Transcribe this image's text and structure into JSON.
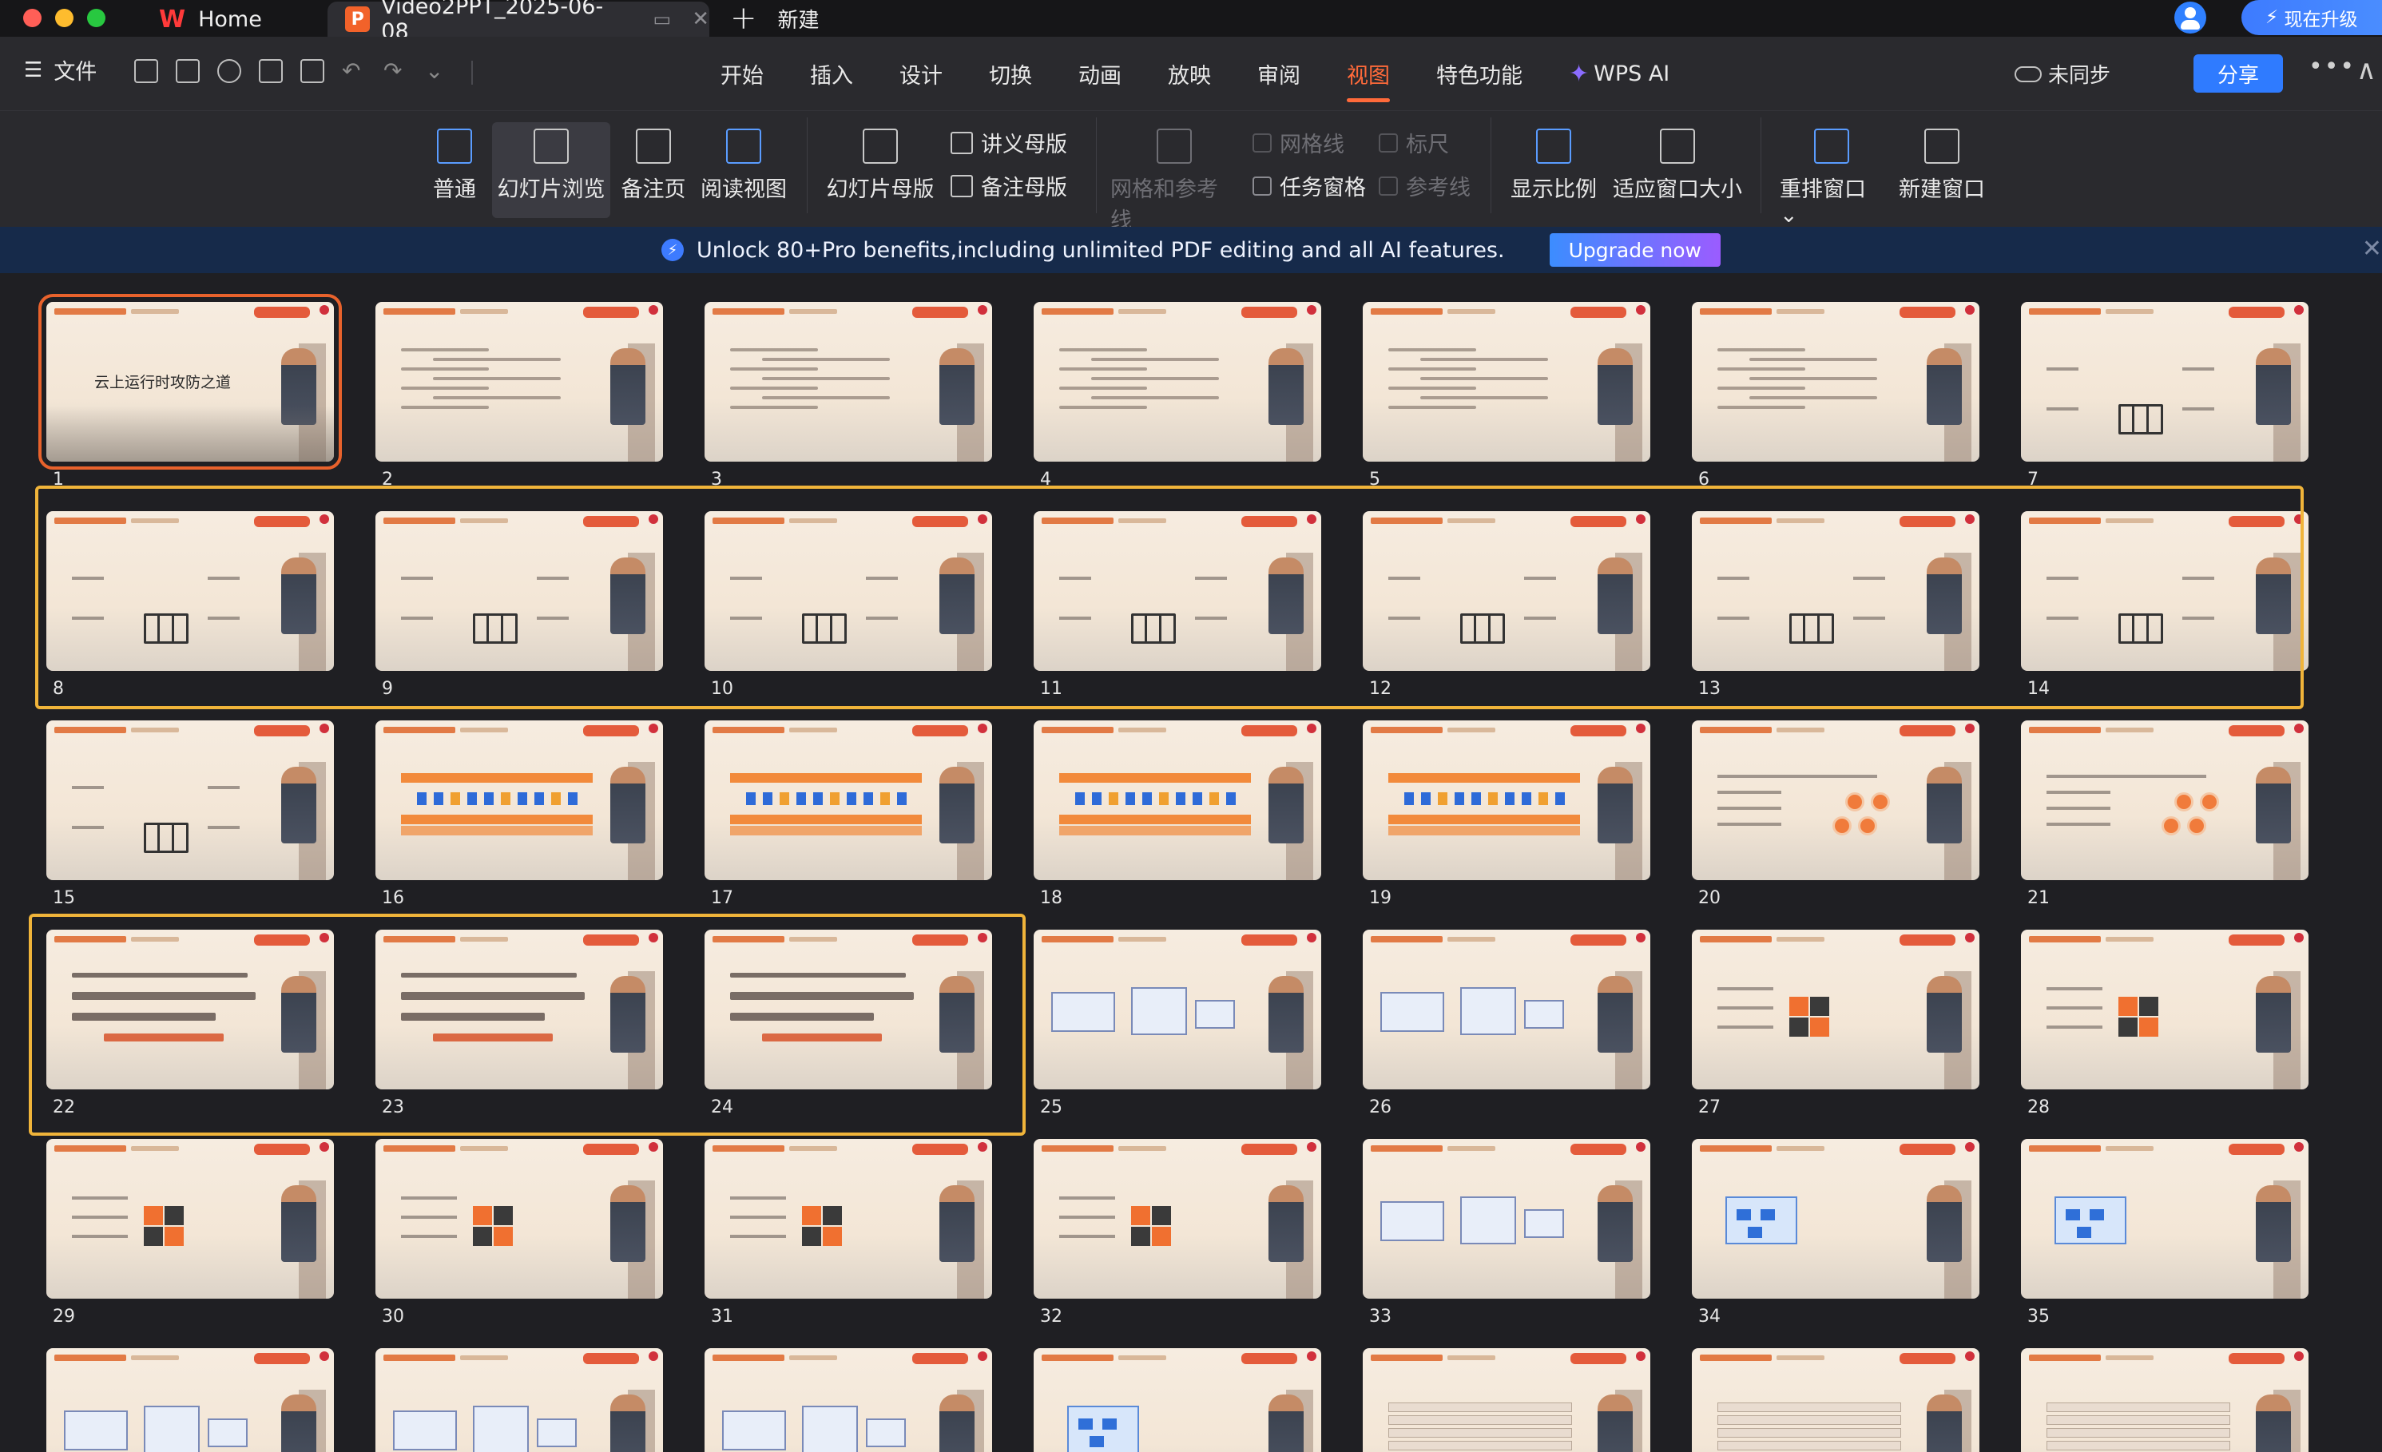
{
  "titlebar": {
    "home_tab": "Home",
    "doc_tab": "Video2PPT_2025-06-08_",
    "new_tab": "新建",
    "upgrade": "现在升级"
  },
  "menubar": {
    "file": "文件",
    "tabs": [
      "开始",
      "插入",
      "设计",
      "切换",
      "动画",
      "放映",
      "审阅",
      "视图",
      "特色功能",
      "WPS AI"
    ],
    "active_tab": "视图",
    "sync": "未同步",
    "share": "分享"
  },
  "ribbon": {
    "normal": "普通",
    "slide_sorter": "幻灯片浏览",
    "notes_page": "备注页",
    "reading_view": "阅读视图",
    "slide_master": "幻灯片母版",
    "handout_master": "讲义母版",
    "notes_master": "备注母版",
    "grid_guides": "网格和参考线",
    "gridlines": "网格线",
    "ruler": "标尺",
    "task_pane": "任务窗格",
    "guides": "参考线",
    "zoom": "显示比例",
    "fit_window": "适应窗口大小",
    "arrange_windows": "重排窗口",
    "new_window": "新建窗口"
  },
  "promo": {
    "text": "Unlock 80+Pro benefits,including unlimited PDF editing and all AI features.",
    "button": "Upgrade now"
  },
  "slide1_title": "云上运行时攻防之道",
  "slides": [
    {
      "n": "1",
      "v": "title"
    },
    {
      "n": "2",
      "v": "text"
    },
    {
      "n": "3",
      "v": "text"
    },
    {
      "n": "4",
      "v": "text"
    },
    {
      "n": "5",
      "v": "text"
    },
    {
      "n": "6",
      "v": "text"
    },
    {
      "n": "7",
      "v": "server"
    },
    {
      "n": "8",
      "v": "server"
    },
    {
      "n": "9",
      "v": "server"
    },
    {
      "n": "10",
      "v": "server"
    },
    {
      "n": "11",
      "v": "server"
    },
    {
      "n": "12",
      "v": "server"
    },
    {
      "n": "13",
      "v": "server"
    },
    {
      "n": "14",
      "v": "server"
    },
    {
      "n": "15",
      "v": "server"
    },
    {
      "n": "16",
      "v": "bars"
    },
    {
      "n": "17",
      "v": "bars"
    },
    {
      "n": "18",
      "v": "bars"
    },
    {
      "n": "19",
      "v": "bars"
    },
    {
      "n": "20",
      "v": "circles"
    },
    {
      "n": "21",
      "v": "circles"
    },
    {
      "n": "22",
      "v": "red"
    },
    {
      "n": "23",
      "v": "red"
    },
    {
      "n": "24",
      "v": "red"
    },
    {
      "n": "25",
      "v": "diagram"
    },
    {
      "n": "26",
      "v": "diagram"
    },
    {
      "n": "27",
      "v": "quad"
    },
    {
      "n": "28",
      "v": "quad"
    },
    {
      "n": "29",
      "v": "quad"
    },
    {
      "n": "30",
      "v": "quad"
    },
    {
      "n": "31",
      "v": "quad"
    },
    {
      "n": "32",
      "v": "quad"
    },
    {
      "n": "33",
      "v": "diagram"
    },
    {
      "n": "34",
      "v": "blue"
    },
    {
      "n": "35",
      "v": "blue"
    },
    {
      "n": "",
      "v": "diagram"
    },
    {
      "n": "",
      "v": "diagram"
    },
    {
      "n": "",
      "v": "diagram"
    },
    {
      "n": "",
      "v": "blue"
    },
    {
      "n": "",
      "v": "table"
    },
    {
      "n": "",
      "v": "table"
    },
    {
      "n": "",
      "v": "table"
    }
  ],
  "colors": {
    "accent": "#ff6a3a",
    "selection_box": "#f0b43a",
    "current_slide": "#e8622c",
    "share": "#2f7bff"
  }
}
